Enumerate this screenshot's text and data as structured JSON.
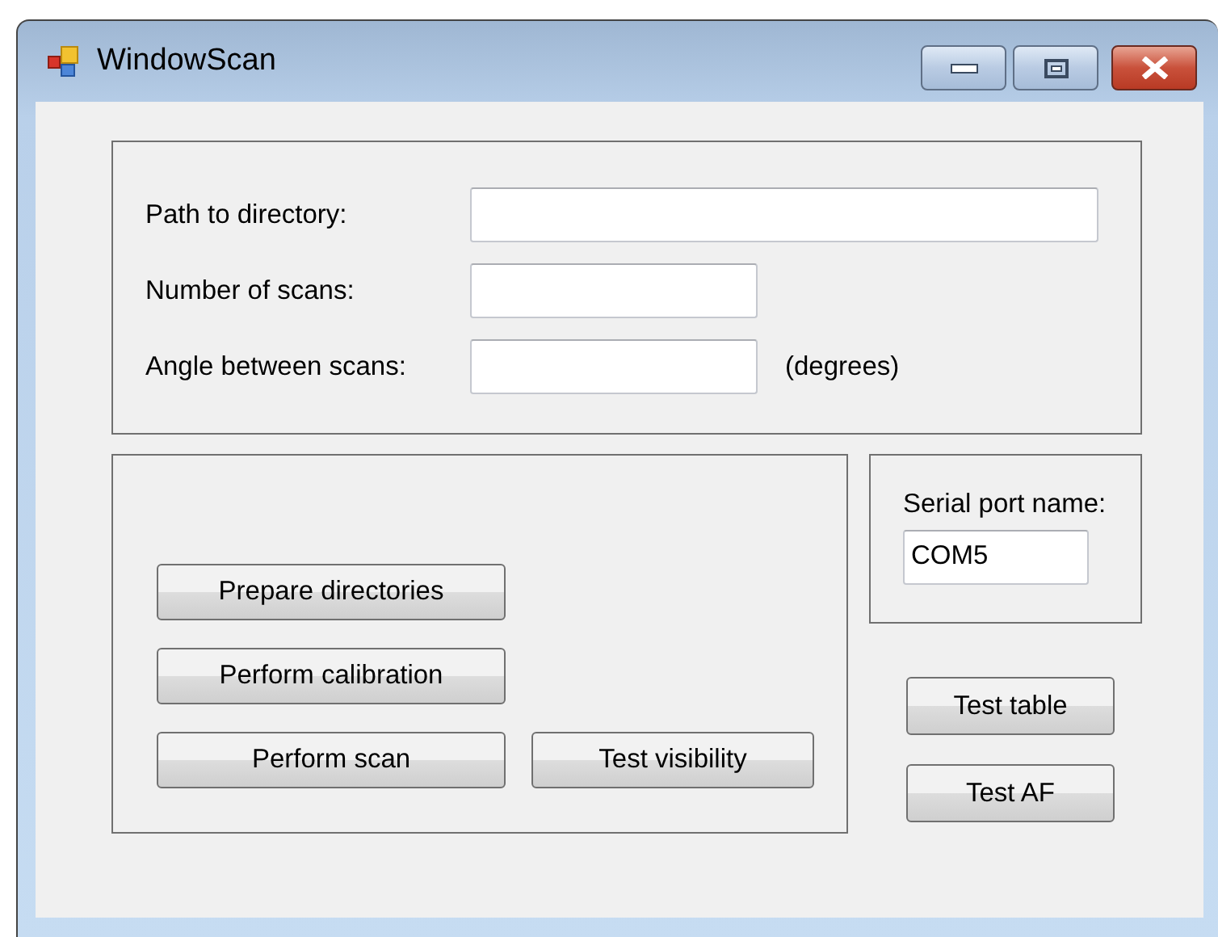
{
  "window": {
    "title": "WindowScan"
  },
  "scan_settings": {
    "fields": [
      {
        "label": "Path to directory:",
        "kind": "long"
      },
      {
        "label": "Number of scans:",
        "kind": "short"
      },
      {
        "label": "Angle between scans:",
        "kind": "short",
        "unit": "(degrees)"
      }
    ]
  },
  "actions": {
    "button_rows": [
      [
        "Prepare directories"
      ],
      [
        "Perform calibration"
      ],
      [
        "Perform scan",
        "Test visibility"
      ]
    ]
  },
  "serial_port": {
    "label": "Serial port name:",
    "value": "COM5"
  },
  "test_buttons": [
    "Test table",
    "Test AF"
  ]
}
